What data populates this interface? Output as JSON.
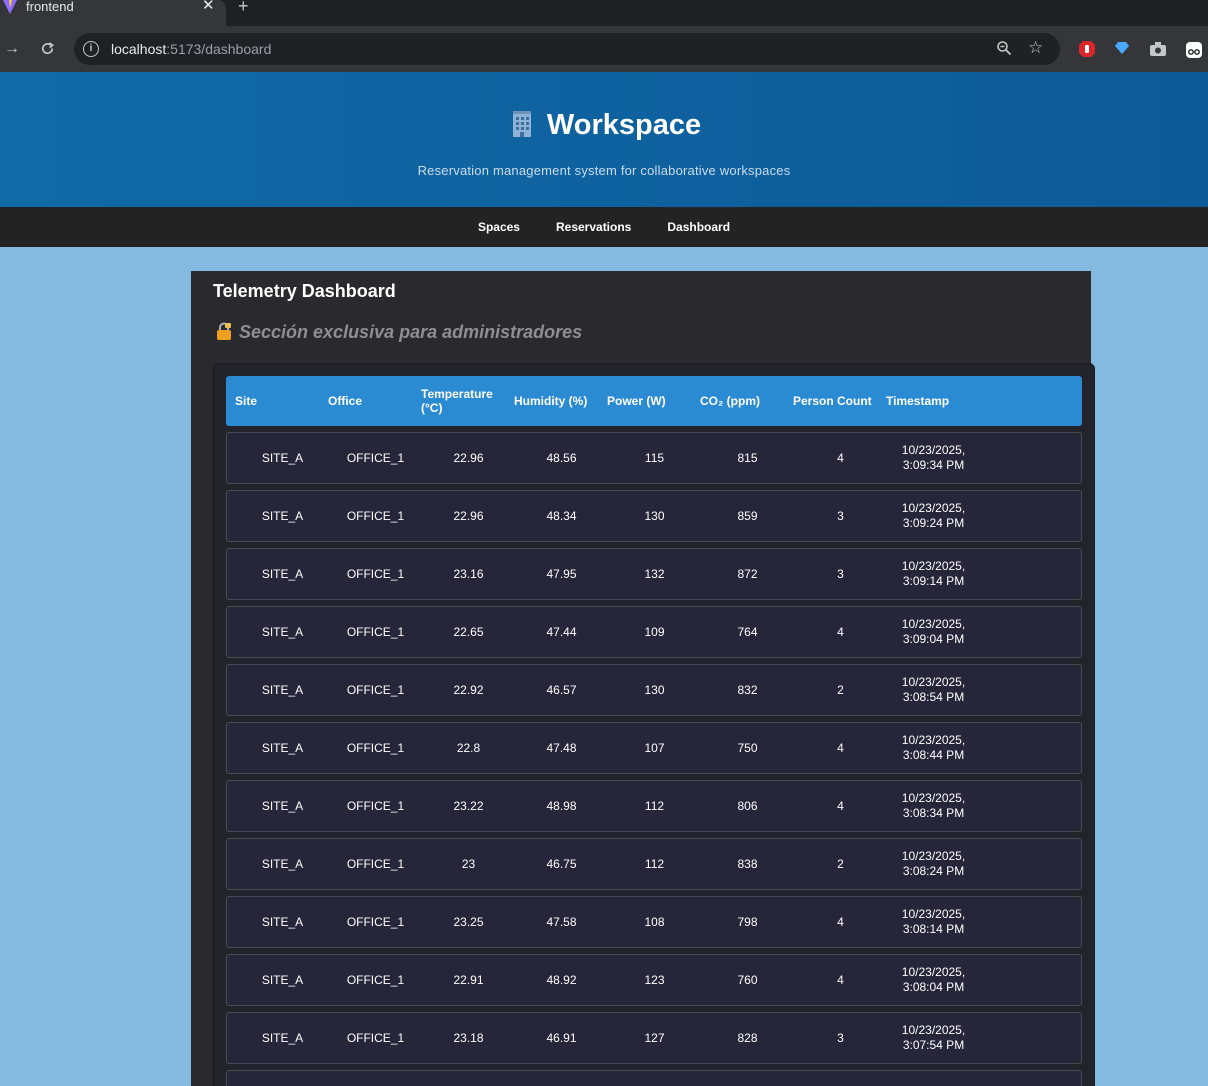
{
  "browser": {
    "tab_title": "frontend",
    "tab_close": "✕",
    "new_tab": "+",
    "url_host": "localhost",
    "url_path": ":5173/dashboard"
  },
  "header": {
    "brand": "Workspace",
    "subtitle": "Reservation management system for collaborative workspaces"
  },
  "nav": {
    "items": [
      "Spaces",
      "Reservations",
      "Dashboard"
    ]
  },
  "dashboard": {
    "title": "Telemetry Dashboard",
    "admin_note": "Sección exclusiva para administradores",
    "columns": [
      "Site",
      "Office",
      "Temperature (°C)",
      "Humidity (%)",
      "Power (W)",
      "CO₂ (ppm)",
      "Person Count",
      "Timestamp"
    ],
    "rows": [
      {
        "site": "SITE_A",
        "office": "OFFICE_1",
        "temperature": "22.96",
        "humidity": "48.56",
        "power": "115",
        "co2": "815",
        "persons": "4",
        "date": "10/23/2025,",
        "time": "3:09:34 PM"
      },
      {
        "site": "SITE_A",
        "office": "OFFICE_1",
        "temperature": "22.96",
        "humidity": "48.34",
        "power": "130",
        "co2": "859",
        "persons": "3",
        "date": "10/23/2025,",
        "time": "3:09:24 PM"
      },
      {
        "site": "SITE_A",
        "office": "OFFICE_1",
        "temperature": "23.16",
        "humidity": "47.95",
        "power": "132",
        "co2": "872",
        "persons": "3",
        "date": "10/23/2025,",
        "time": "3:09:14 PM"
      },
      {
        "site": "SITE_A",
        "office": "OFFICE_1",
        "temperature": "22.65",
        "humidity": "47.44",
        "power": "109",
        "co2": "764",
        "persons": "4",
        "date": "10/23/2025,",
        "time": "3:09:04 PM"
      },
      {
        "site": "SITE_A",
        "office": "OFFICE_1",
        "temperature": "22.92",
        "humidity": "46.57",
        "power": "130",
        "co2": "832",
        "persons": "2",
        "date": "10/23/2025,",
        "time": "3:08:54 PM"
      },
      {
        "site": "SITE_A",
        "office": "OFFICE_1",
        "temperature": "22.8",
        "humidity": "47.48",
        "power": "107",
        "co2": "750",
        "persons": "4",
        "date": "10/23/2025,",
        "time": "3:08:44 PM"
      },
      {
        "site": "SITE_A",
        "office": "OFFICE_1",
        "temperature": "23.22",
        "humidity": "48.98",
        "power": "112",
        "co2": "806",
        "persons": "4",
        "date": "10/23/2025,",
        "time": "3:08:34 PM"
      },
      {
        "site": "SITE_A",
        "office": "OFFICE_1",
        "temperature": "23",
        "humidity": "46.75",
        "power": "112",
        "co2": "838",
        "persons": "2",
        "date": "10/23/2025,",
        "time": "3:08:24 PM"
      },
      {
        "site": "SITE_A",
        "office": "OFFICE_1",
        "temperature": "23.25",
        "humidity": "47.58",
        "power": "108",
        "co2": "798",
        "persons": "4",
        "date": "10/23/2025,",
        "time": "3:08:14 PM"
      },
      {
        "site": "SITE_A",
        "office": "OFFICE_1",
        "temperature": "22.91",
        "humidity": "48.92",
        "power": "123",
        "co2": "760",
        "persons": "4",
        "date": "10/23/2025,",
        "time": "3:08:04 PM"
      },
      {
        "site": "SITE_A",
        "office": "OFFICE_1",
        "temperature": "23.18",
        "humidity": "46.91",
        "power": "127",
        "co2": "828",
        "persons": "3",
        "date": "10/23/2025,",
        "time": "3:07:54 PM"
      }
    ]
  },
  "colors": {
    "page_bg": "#84b9e0",
    "header_bg": "#0f6aa6",
    "nav_bg": "#232323",
    "panel_bg": "#2a2a2e",
    "table_header_bg": "#2b8bd2",
    "row_bg": "#26253a"
  },
  "icons": {
    "brand": "office-building-icon",
    "admin_note": "lock-icon",
    "browser": [
      "back-arrow-icon",
      "forward-arrow-icon",
      "reload-icon",
      "site-info-icon",
      "zoom-icon",
      "bookmark-star-icon",
      "extension-icon",
      "profile-icon"
    ]
  }
}
